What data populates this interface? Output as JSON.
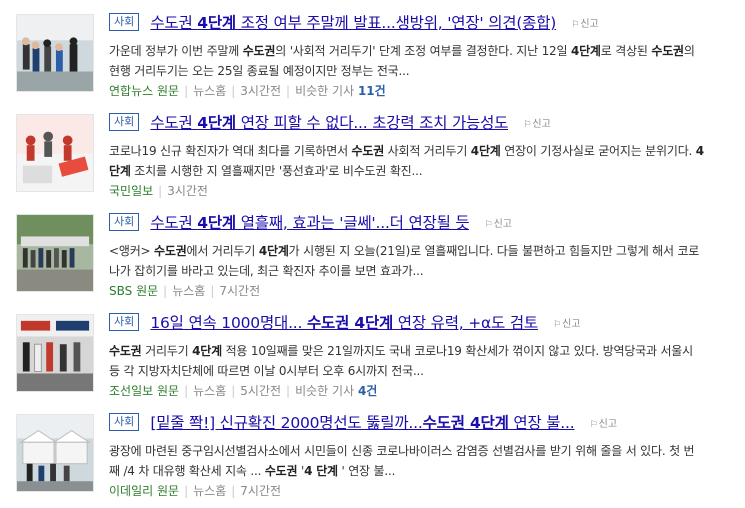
{
  "news": [
    {
      "category": "사회",
      "title": [
        "수도권 ",
        "4단계",
        " 조정 여부 주말께 발표...생방위, '연장' 의견(종합)"
      ],
      "report": "신고",
      "desc": [
        "가운데 정부가 이번 주말께 ",
        "수도권",
        "의 '사회적 거리두기' 단계 조정 여부를 결정한다. 지난 12일 ",
        "4단계",
        "로 격상된 ",
        "수도권",
        "의 현행 거리두기는 오는 25일 종료될 예정이지만 정부는 전국..."
      ],
      "source": "연합뉴스 원문",
      "section": "뉴스홈",
      "time": "3시간전",
      "similar": "비슷한 기사",
      "similar_count": "11건"
    },
    {
      "category": "사회",
      "title": [
        "수도권 ",
        "4단계",
        " 연장 피할 수 없다... 초강력 조치 가능성도"
      ],
      "report": "신고",
      "desc": [
        "코로나19 신규 확진자가 역대 최다를 기록하면서 ",
        "수도권",
        " 사회적 거리두기 ",
        "4단계",
        " 연장이 기정사실로 굳어지는 분위기다. ",
        "4단계",
        " 조치를 시행한 지 열흘째지만 '풍선효과'로 비수도권 확진..."
      ],
      "source": "국민일보",
      "time": "3시간전"
    },
    {
      "category": "사회",
      "title": [
        "수도권 ",
        "4단계",
        " 열흘째, 효과는 '글쎄'...더 연장될 듯"
      ],
      "report": "신고",
      "desc": [
        "<앵커> ",
        "수도권",
        "에서 거리두기 ",
        "4단계",
        "가 시행된 지 오늘(21일)로 열흘째입니다. 다들 불편하고 힘들지만 그렇게 해서 코로나가 잡히기를 바라고 있는데, 최근 확진자 추이를 보면 효과가..."
      ],
      "source": "SBS 원문",
      "section": "뉴스홈",
      "time": "7시간전"
    },
    {
      "category": "사회",
      "title": [
        "16일 연속 1000명대... ",
        "수도권 4단계",
        " 연장 유력, +α도 검토"
      ],
      "report": "신고",
      "desc": [
        "수도권",
        " 거리두기 ",
        "4단계",
        " 적용 10일째를 맞은 21일까지도 국내 코로나19 확산세가 꺾이지 않고 있다. 방역당국과 서울시 등 각 지방자치단체에 따르면 이날 0시부터 오후 6시까지 전국..."
      ],
      "source": "조선일보 원문",
      "section": "뉴스홈",
      "time": "5시간전",
      "similar": "비슷한 기사",
      "similar_count": "4건"
    },
    {
      "category": "사회",
      "title": [
        "[밑줄 쫙!] 신규확진 2000명선도 뚫릴까...",
        "수도권 4단계",
        " 연장 불..."
      ],
      "report": "신고",
      "desc": [
        "광장에 마련된 중구임시선별검사소에서 시민들이 신종 코로나바이러스 감염증 선별검사를 받기 위해 줄을 서 있다. 첫 번째 /4 차 대유행 확산세 지속 ... ",
        "수도권",
        " '",
        "4 단계",
        " ' 연장 불..."
      ],
      "source": "이데일리 원문",
      "section": "뉴스홈",
      "time": "7시간전"
    }
  ],
  "colors": {
    "title": "#1a0dab",
    "badge": "#2a5ea8",
    "source": "#2d7d2d",
    "count": "#2a5ea8"
  }
}
